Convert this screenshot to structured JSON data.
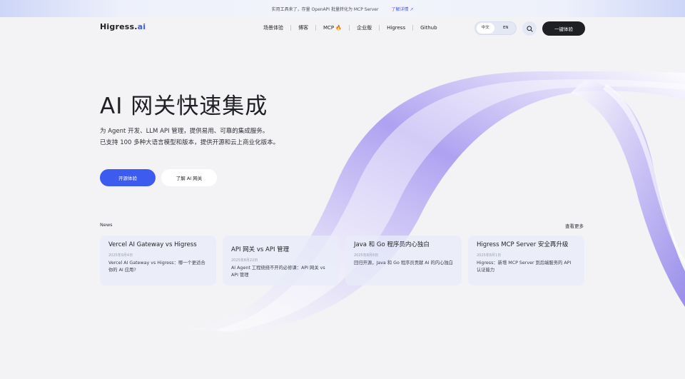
{
  "banner": {
    "text": "实用工具来了，存量 OpenAPI 批量转化为 MCP Server",
    "link_label": "了解详情 ↗"
  },
  "header": {
    "logo_main": "Higress.",
    "logo_accent": "ai",
    "nav": [
      "场景体验",
      "博客",
      "MCP",
      "企业版",
      "Higress",
      "Github"
    ],
    "lang_zh": "中文",
    "lang_en": "EN",
    "cta": "一键体验"
  },
  "hero": {
    "title": "AI 网关快速集成",
    "desc_line1": "为 Agent 开发、LLM API 管理，提供易用、可靠的集成服务。",
    "desc_line2": "已支持 100 多种大语言模型和版本，提供开源和云上商业化版本。",
    "primary_btn": "开源体验",
    "secondary_btn": "了解 AI 网关"
  },
  "news": {
    "label": "News",
    "more": "查看更多",
    "cards": [
      {
        "title": "Vercel AI Gateway vs Higress",
        "date": "2025年9月4日",
        "desc": "Vercel AI Gateway vs Higress：哪一个更适合你的 AI 应用?"
      },
      {
        "title": "API 网关 vs API 管理",
        "date": "2025年8月22日",
        "desc": "AI Agent 工程绕绕不开的必修课：API 网关 vs API 管理"
      },
      {
        "title": "Java 和 Go 程序员内心独白",
        "date": "2025年8月8日",
        "desc": "回归开源，Java 和 Go 程序员贡献 AI 的内心独白"
      },
      {
        "title": "Higress MCP Server 安全再升级",
        "date": "2025年8月1日",
        "desc": "Higress：新增 MCP Server 到后端服务的 API 认证能力"
      }
    ]
  },
  "colors": {
    "accent": "#3e5bf0",
    "dark": "#1f2024",
    "background": "#f3f3f6",
    "ribbon": "#a99cf2"
  }
}
